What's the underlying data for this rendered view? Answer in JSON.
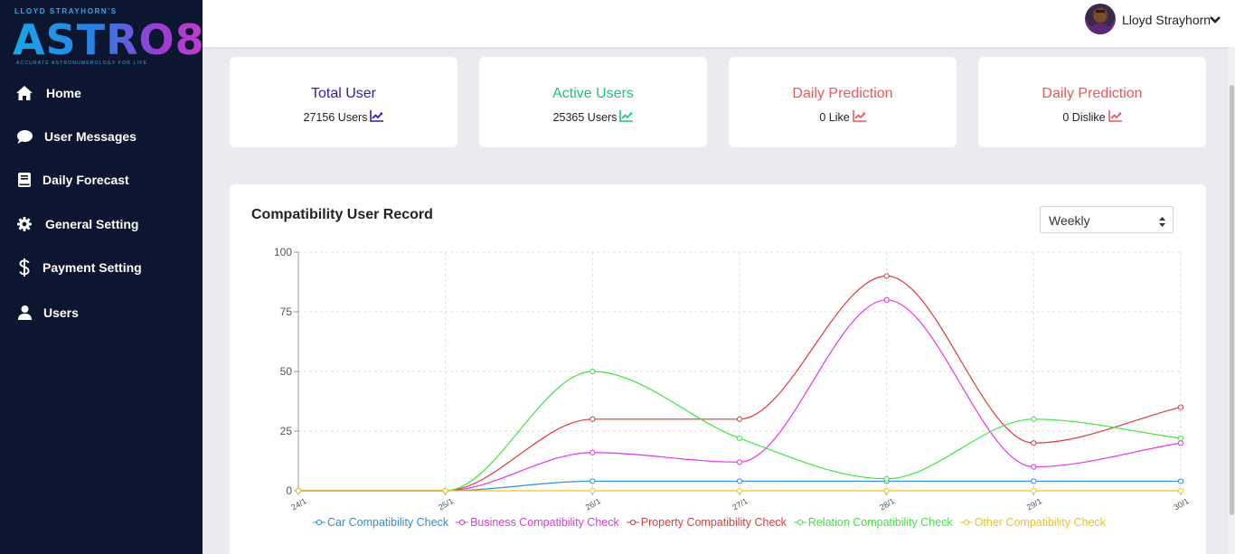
{
  "brand": {
    "top_text": "LLOYD STRAYHORN'S",
    "main_text": "ASTRO8",
    "sub_text": "ACCURATE ASTRONUMEROLOGY FOR LIFE"
  },
  "sidebar": {
    "items": [
      {
        "label": "Home",
        "icon": "home-icon"
      },
      {
        "label": "User Messages",
        "icon": "comment-icon"
      },
      {
        "label": "Daily Forecast",
        "icon": "book-icon"
      },
      {
        "label": "General Setting",
        "icon": "gear-icon"
      },
      {
        "label": "Payment Setting",
        "icon": "dollar-icon"
      },
      {
        "label": "Users",
        "icon": "user-icon"
      }
    ]
  },
  "header": {
    "user_name": "Lloyd Strayhorn"
  },
  "cards": [
    {
      "title": "Total User",
      "value": "27156 Users",
      "color": "#2a1fb4"
    },
    {
      "title": "Active Users",
      "value": "25365 Users",
      "color": "#21c27a"
    },
    {
      "title": "Daily Prediction",
      "value": "0 Like",
      "color": "#e85a5a"
    },
    {
      "title": "Daily Prediction",
      "value": "0 Dislike",
      "color": "#e85a5a"
    }
  ],
  "panel": {
    "title": "Compatibility User Record",
    "period_select": "Weekly"
  },
  "chart_data": {
    "type": "line",
    "x": [
      "24/1",
      "25/1",
      "26/1",
      "27/1",
      "28/1",
      "29/1",
      "30/1"
    ],
    "ylim": [
      0,
      100
    ],
    "yticks": [
      "0",
      "25",
      "50",
      "75",
      "100"
    ],
    "grid": true,
    "legend_position": "bottom",
    "series": [
      {
        "name": "Car Compatibility Check",
        "color": "#2f8fde",
        "values": [
          0,
          0,
          4,
          4,
          4,
          4,
          4
        ]
      },
      {
        "name": "Business Compatibility Check",
        "color": "#e536e5",
        "values": [
          0,
          0,
          16,
          12,
          80,
          10,
          20
        ]
      },
      {
        "name": "Property Compatibility Check",
        "color": "#e03b3b",
        "values": [
          0,
          0,
          30,
          30,
          90,
          20,
          35
        ]
      },
      {
        "name": "Relation Compatibility Check",
        "color": "#3ee63e",
        "values": [
          0,
          0,
          50,
          22,
          5,
          30,
          22
        ]
      },
      {
        "name": "Other Compatibility Check",
        "color": "#f0c419",
        "values": [
          0,
          0,
          0,
          0,
          0,
          0,
          0
        ]
      }
    ]
  }
}
